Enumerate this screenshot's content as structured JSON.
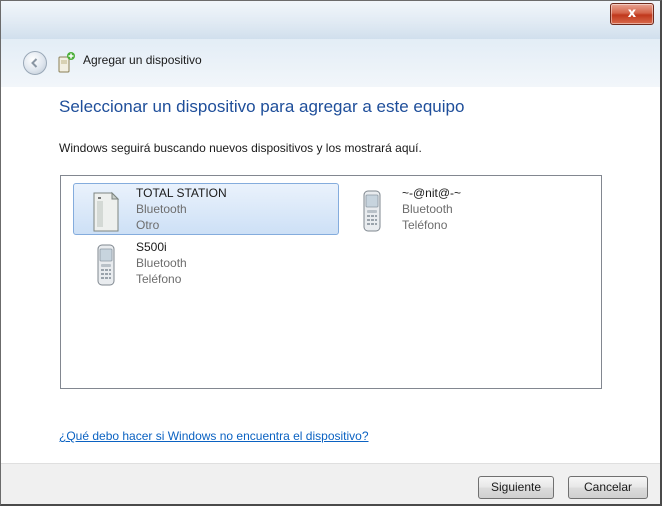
{
  "window": {
    "title": "Agregar un dispositivo",
    "close_glyph": "x"
  },
  "main": {
    "heading": "Seleccionar un dispositivo para agregar a este equipo",
    "description": "Windows seguirá buscando nuevos dispositivos y los mostrará aquí.",
    "help_link": "¿Qué debo hacer si Windows no encuentra el dispositivo?"
  },
  "devices": [
    {
      "name": "TOTAL STATION",
      "connection": "Bluetooth",
      "category": "Otro",
      "icon": "generic-device-icon",
      "selected": true
    },
    {
      "name": "~-@nit@-~",
      "connection": "Bluetooth",
      "category": "Teléfono",
      "icon": "phone-icon",
      "selected": false
    },
    {
      "name": "S500i",
      "connection": "Bluetooth",
      "category": "Teléfono",
      "icon": "phone-icon",
      "selected": false
    }
  ],
  "footer": {
    "next_label": "Siguiente",
    "cancel_label": "Cancelar"
  },
  "colors": {
    "heading": "#1e4e9a",
    "link": "#0b62c2",
    "selection_border": "#84acdd",
    "close_button": "#c0381c"
  }
}
